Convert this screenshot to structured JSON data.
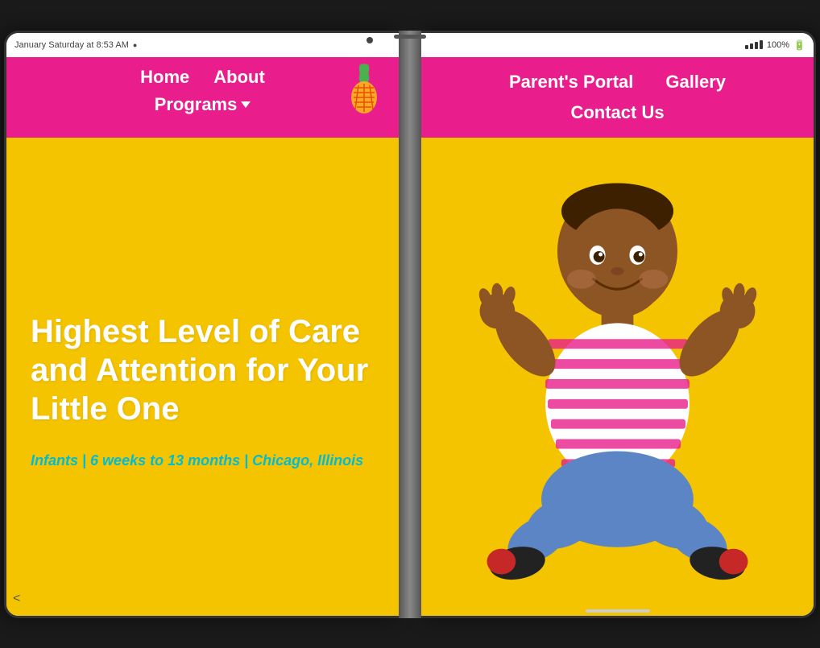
{
  "device": {
    "left_status": {
      "time": "January Saturday at 8:53 AM",
      "icon": "●"
    },
    "right_status": {
      "signal": "100%",
      "battery": "🔋"
    }
  },
  "nav": {
    "home_label": "Home",
    "about_label": "About",
    "programs_label": "Programs",
    "parents_portal_label": "Parent's Portal",
    "gallery_label": "Gallery",
    "contact_label": "Contact Us",
    "logo_emoji": "🍍"
  },
  "hero": {
    "title": "Highest Level of Care and Attention for Your Little One",
    "subtitle": "Infants | 6 weeks to 13 months | Chicago, Illinois"
  },
  "colors": {
    "nav_bg": "#e91e8c",
    "hero_bg": "#f5c400",
    "title_color": "#ffffff",
    "subtitle_color": "#00bcd4"
  }
}
